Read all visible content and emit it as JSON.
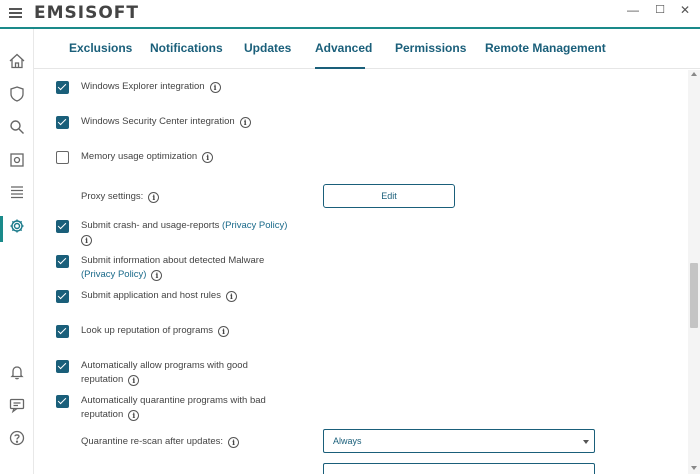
{
  "app": {
    "logo": "EMSISOFT",
    "window_controls": {
      "minimize": "—",
      "maximize": "☐",
      "close": "✕"
    }
  },
  "tabs": [
    {
      "label": "Exclusions",
      "active": false
    },
    {
      "label": "Notifications",
      "active": false
    },
    {
      "label": "Updates",
      "active": false
    },
    {
      "label": "Advanced",
      "active": true
    },
    {
      "label": "Permissions",
      "active": false
    },
    {
      "label": "Remote Management",
      "active": false
    }
  ],
  "sidebar": {
    "icons": [
      "home-icon",
      "shield-icon",
      "search-icon",
      "quarantine-icon",
      "logs-icon",
      "settings-icon",
      "bell-icon",
      "chat-icon",
      "help-icon"
    ],
    "active": "settings-icon"
  },
  "settings": {
    "explorer": {
      "label": "Windows Explorer integration",
      "checked": true
    },
    "security_center": {
      "label": "Windows Security Center integration",
      "checked": true
    },
    "memory": {
      "label": "Memory usage optimization",
      "checked": false
    },
    "proxy": {
      "label": "Proxy settings:",
      "button": "Edit"
    },
    "crash": {
      "label": "Submit crash- and usage-reports",
      "link": "(Privacy Policy)",
      "checked": true
    },
    "malware": {
      "label_line1": "Submit information about detected Malware",
      "link": "(Privacy Policy)",
      "checked": true
    },
    "host_rules": {
      "label": "Submit application and host rules",
      "checked": true
    },
    "reputation": {
      "label": "Look up reputation of programs",
      "checked": true
    },
    "allow_good": {
      "label_line1": "Automatically allow programs with good",
      "label_line2": "reputation",
      "checked": true
    },
    "quarantine_bad": {
      "label_line1": "Automatically quarantine programs with bad",
      "label_line2": "reputation",
      "checked": true
    },
    "rescan": {
      "label": "Quarantine re-scan after updates:",
      "value": "Always"
    }
  },
  "info_glyph": "i",
  "colors": {
    "accent": "#1a5f7a",
    "teal": "#1a8a8a"
  }
}
